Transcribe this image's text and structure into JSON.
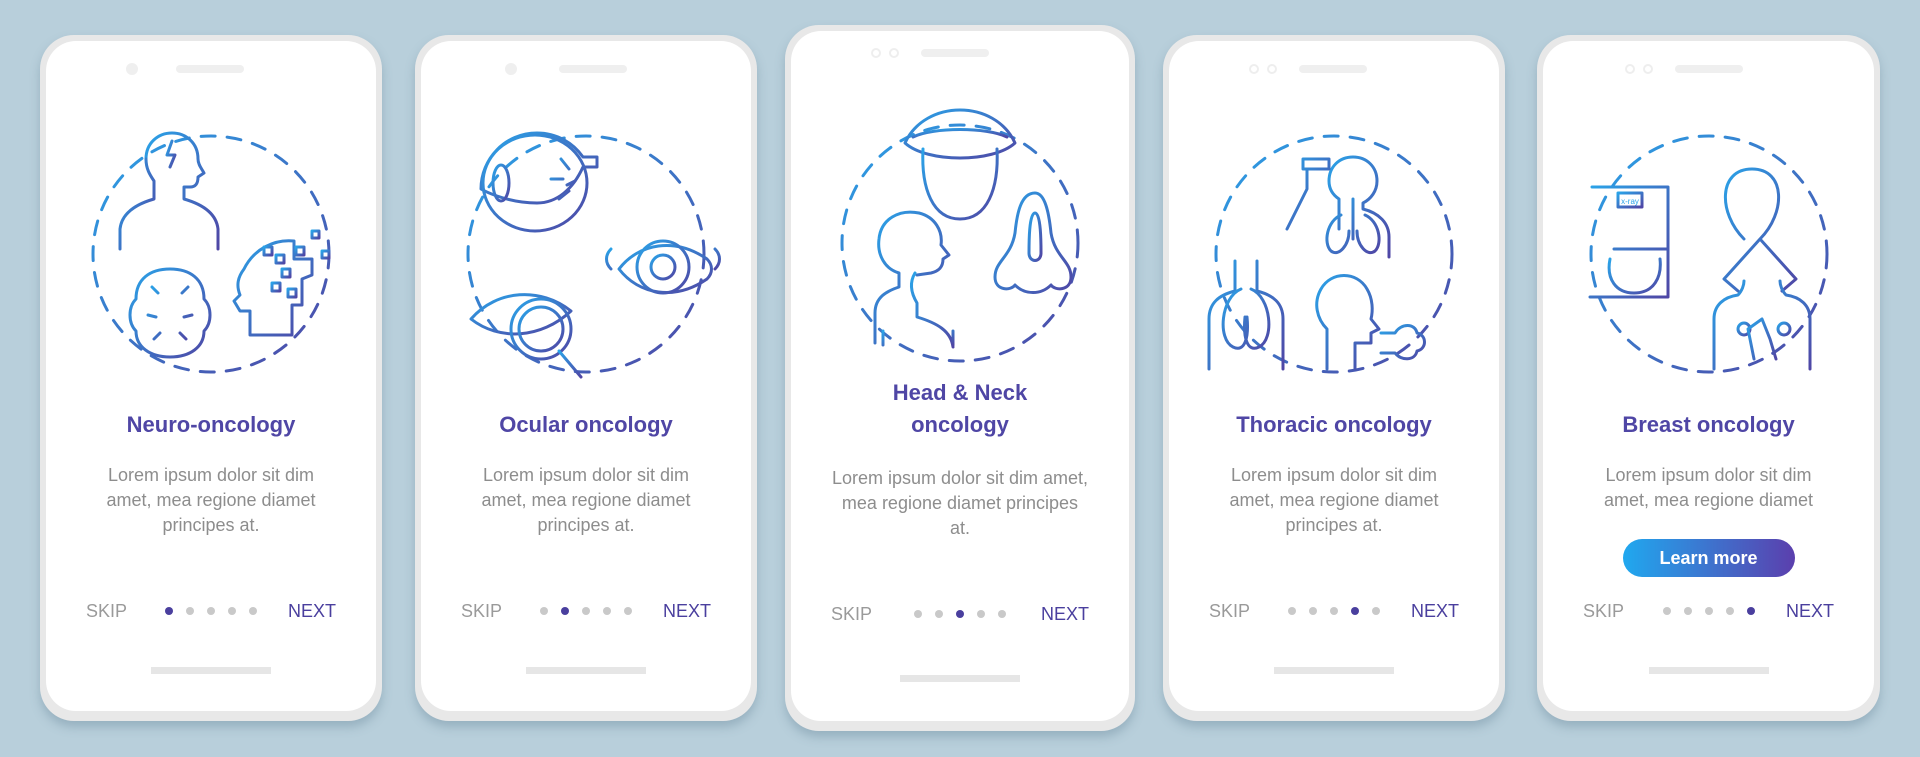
{
  "colors": {
    "background": "#b8cfdb",
    "title": "#4f46a5",
    "body_text": "#8d8d8d",
    "next": "#4a3f9e",
    "dot_active": "#4a3f9e",
    "dot_inactive": "#c9c9c9",
    "icon_gradient_start": "#2aa3e8",
    "icon_gradient_end": "#4f46a5",
    "button_gradient": [
      "#20a8ef",
      "#5b3fad"
    ]
  },
  "screens": [
    {
      "title": "Neuro-oncology",
      "description": "Lorem ipsum dolor sit dim amet, mea regione diamet principes at.",
      "illustration": "neuro-oncology-icon",
      "skip_label": "SKIP",
      "next_label": "NEXT",
      "page_index": 1,
      "page_count": 5
    },
    {
      "title": "Ocular oncology",
      "description": "Lorem ipsum dolor sit dim amet, mea regione diamet principes at.",
      "illustration": "ocular-oncology-icon",
      "skip_label": "SKIP",
      "next_label": "NEXT",
      "page_index": 2,
      "page_count": 5
    },
    {
      "title": "Head & Neck oncology",
      "description": "Lorem ipsum dolor sit dim amet, mea regione diamet principes at.",
      "illustration": "head-neck-oncology-icon",
      "skip_label": "SKIP",
      "next_label": "NEXT",
      "page_index": 3,
      "page_count": 5
    },
    {
      "title": "Thoracic oncology",
      "description": "Lorem ipsum dolor sit dim amet, mea regione diamet principes at.",
      "illustration": "thoracic-oncology-icon",
      "skip_label": "SKIP",
      "next_label": "NEXT",
      "page_index": 4,
      "page_count": 5
    },
    {
      "title": "Breast oncology",
      "description": "Lorem ipsum dolor sit dim amet, mea regione diamet",
      "illustration": "breast-oncology-icon",
      "xray_label": "x-ray",
      "button_label": "Learn more",
      "skip_label": "SKIP",
      "next_label": "NEXT",
      "page_index": 5,
      "page_count": 5
    }
  ]
}
